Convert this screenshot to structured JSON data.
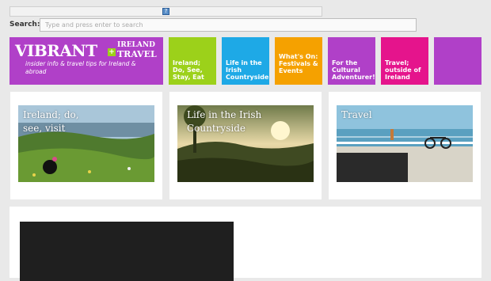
{
  "search": {
    "label": "Search:",
    "placeholder": "Type and press enter to search"
  },
  "topbar": {
    "icon_glyph": "?"
  },
  "logo": {
    "main": "VIBRANT",
    "plus": "+",
    "word1": "IRELAND",
    "word2": "TRAVEL",
    "tagline": "insider info & travel tips for Ireland & abroad"
  },
  "nav": [
    {
      "label": "Ireland; Do, See, Stay, Eat",
      "color": "#9cd11a"
    },
    {
      "label": "Life in the Irish Countryside",
      "color": "#1ea9e6"
    },
    {
      "label": "What's On: Festivals & Events",
      "color": "#f5a100"
    },
    {
      "label": "For the Cultural Adventurer!",
      "color": "#b040c8"
    },
    {
      "label": "Travel; outside of Ireland",
      "color": "#e5148c"
    },
    {
      "label": "",
      "color": "#b040c8"
    }
  ],
  "cards": [
    {
      "caption": "Ireland; do, see, visit"
    },
    {
      "caption": "Life in the Irish Countryside"
    },
    {
      "caption": "Travel"
    }
  ],
  "colors": {
    "purple": "#b040c8",
    "green": "#9cd11a",
    "blue": "#1ea9e6",
    "orange": "#f5a100",
    "pink": "#e5148c"
  }
}
